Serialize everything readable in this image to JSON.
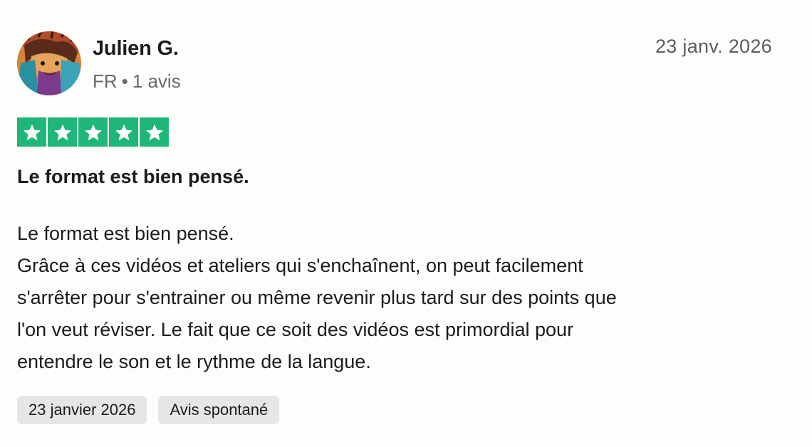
{
  "reviewer": {
    "name": "Julien G.",
    "country": "FR",
    "separator": "•",
    "review_count": "1 avis",
    "avatar_icon": "avatar-image"
  },
  "review": {
    "date": "23 janv. 2026",
    "rating": 5,
    "max_rating": 5,
    "star_color": "#1fb67a",
    "title": "Le format est bien pensé.",
    "body_lines": [
      "Le format est bien pensé.",
      "Grâce à ces vidéos et ateliers qui s'enchaînent, on peut facilement",
      "s'arrêter pour s'entrainer ou même revenir plus tard sur des points que",
      "l'on veut réviser. Le fait que ce soit des vidéos est primordial pour",
      "entendre le son et le rythme de la langue."
    ]
  },
  "tags": {
    "experience_date": "23 janvier 2026",
    "review_type": "Avis spontané"
  }
}
